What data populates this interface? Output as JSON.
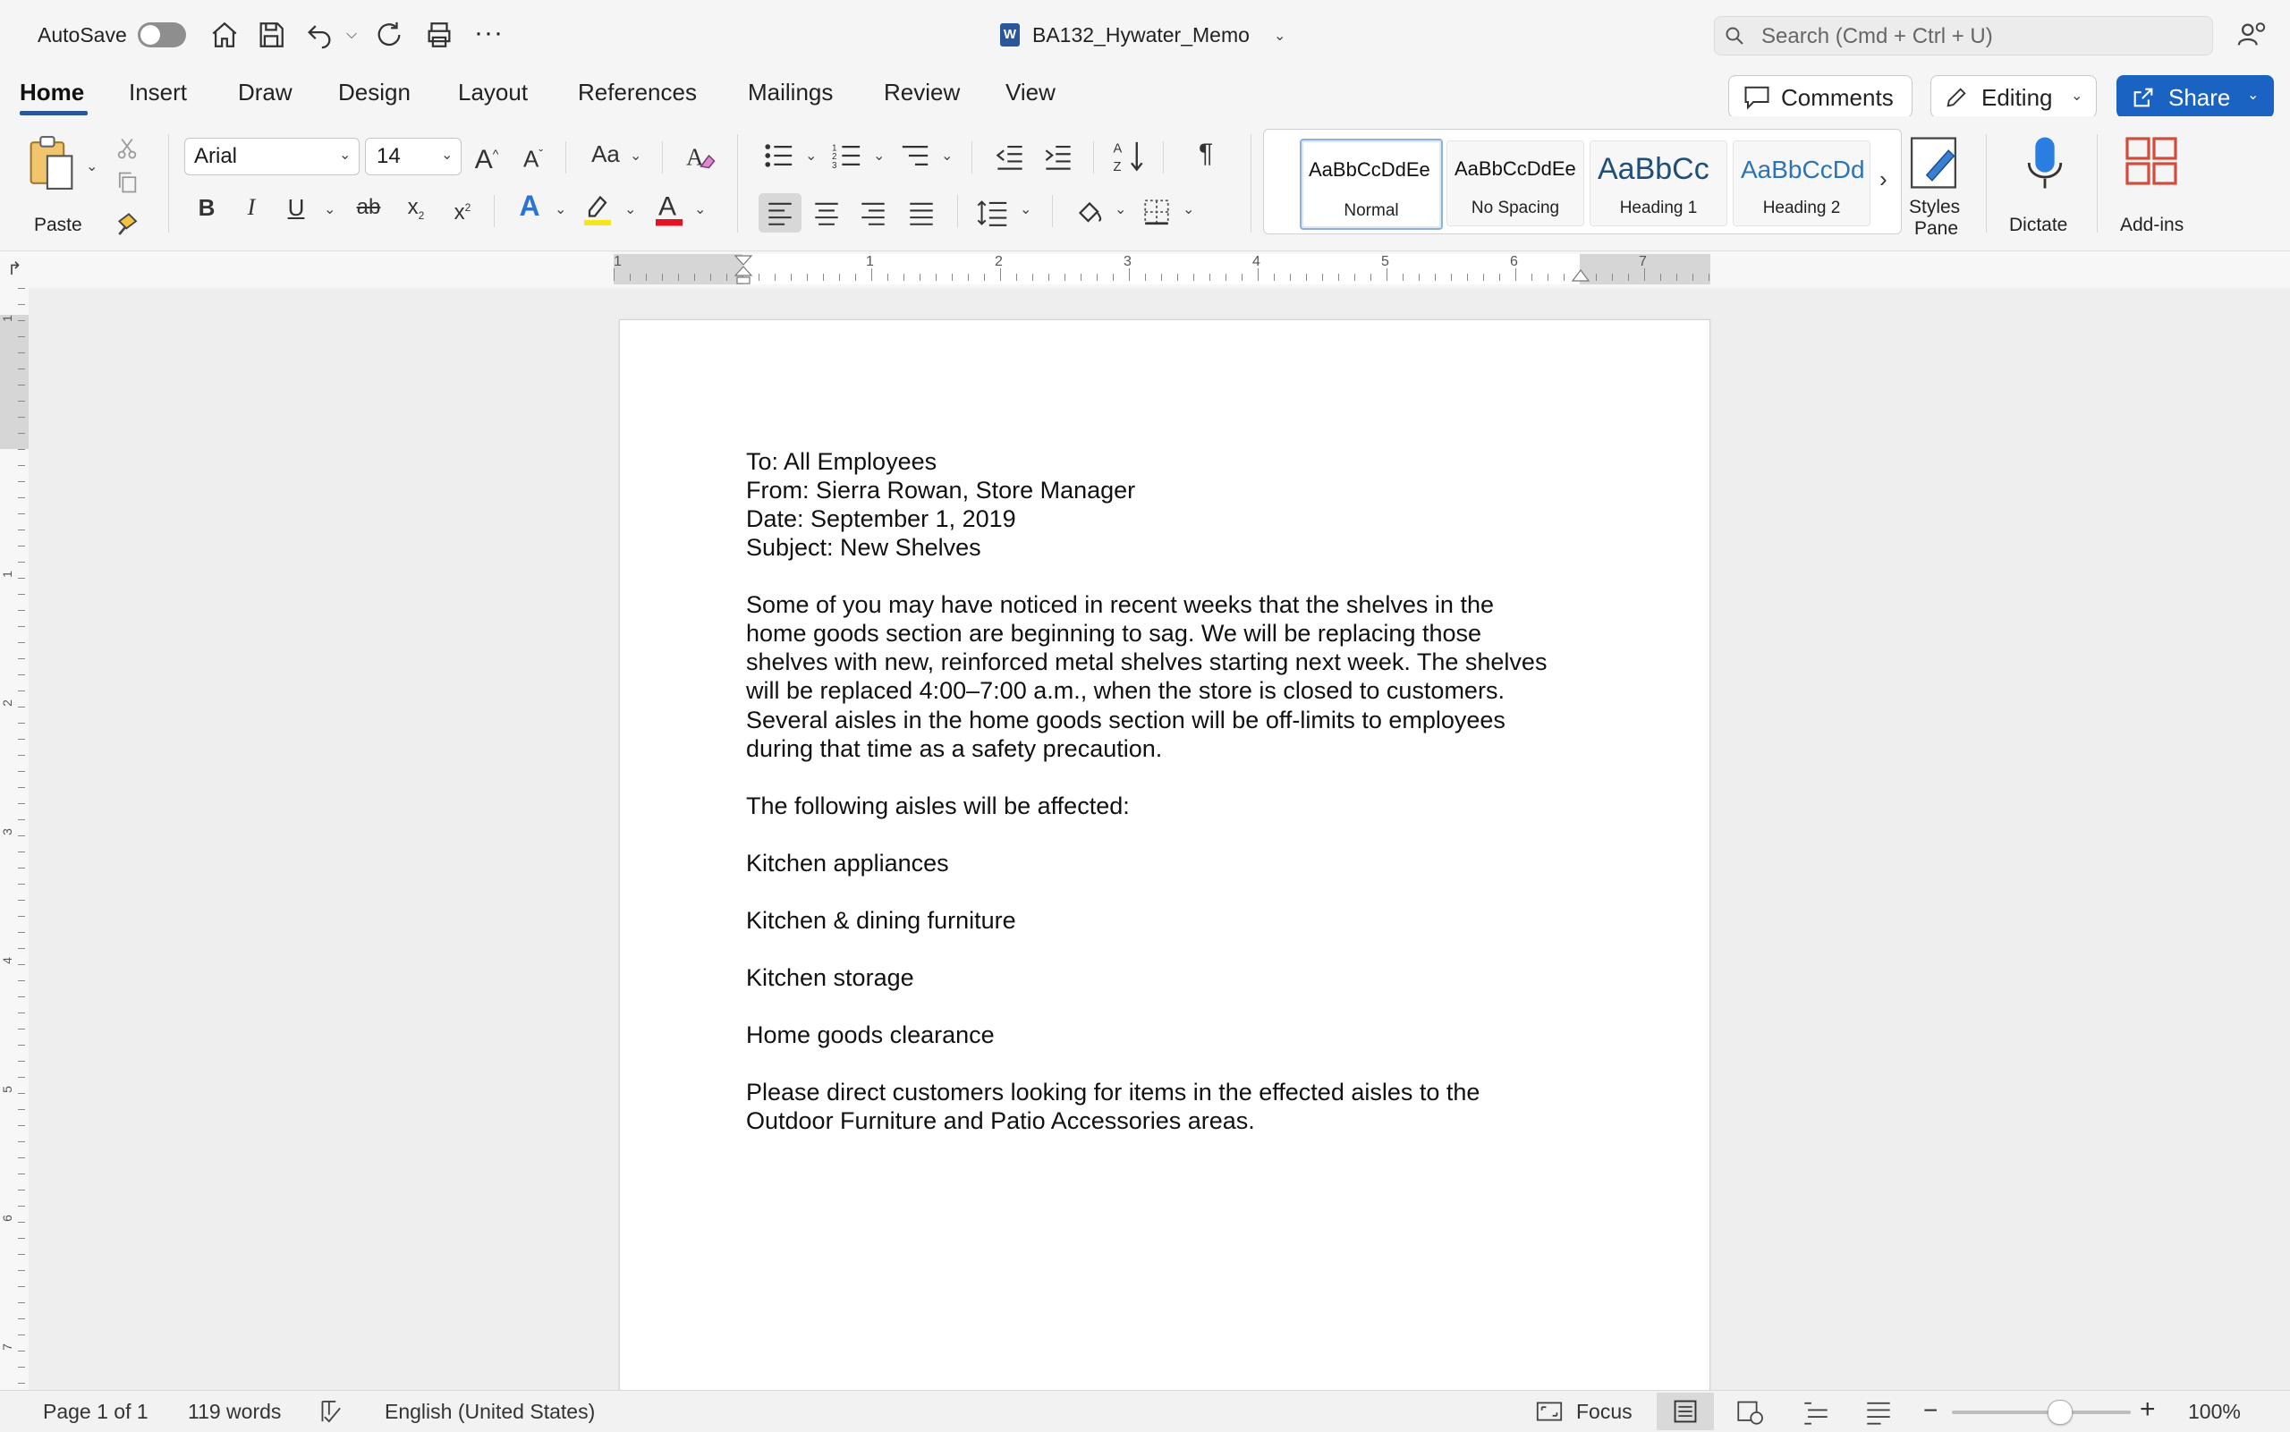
{
  "titlebar": {
    "autosave_label": "AutoSave",
    "doc_title": "BA132_Hywater_Memo",
    "search_placeholder": "Search (Cmd + Ctrl + U)"
  },
  "tabs": [
    {
      "label": "Home",
      "active": true
    },
    {
      "label": "Insert"
    },
    {
      "label": "Draw"
    },
    {
      "label": "Design"
    },
    {
      "label": "Layout"
    },
    {
      "label": "References"
    },
    {
      "label": "Mailings"
    },
    {
      "label": "Review"
    },
    {
      "label": "View"
    }
  ],
  "actions": {
    "comments_label": "Comments",
    "editing_label": "Editing",
    "share_label": "Share"
  },
  "ribbon": {
    "paste_label": "Paste",
    "font_name": "Arial",
    "font_size": "14",
    "styles": [
      {
        "sample": "AaBbCcDdEe",
        "name": "Normal",
        "selected": true
      },
      {
        "sample": "AaBbCcDdEe",
        "name": "No Spacing"
      },
      {
        "sample": "AaBbCc",
        "name": "Heading 1"
      },
      {
        "sample": "AaBbCcDd",
        "name": "Heading 2"
      }
    ],
    "styles_pane_label_1": "Styles",
    "styles_pane_label_2": "Pane",
    "dictate_label": "Dictate",
    "addins_label": "Add-ins",
    "highlight_color": "#f5e51b",
    "font_color": "#e81123"
  },
  "ruler": {
    "h_numbers": [
      "1",
      "1",
      "2",
      "3",
      "4",
      "5",
      "6",
      "7"
    ],
    "v_numbers": [
      "1",
      "1",
      "2",
      "3",
      "4",
      "5",
      "6",
      "7"
    ]
  },
  "document": {
    "header_lines": [
      "To: All Employees",
      "From: Sierra Rowan, Store Manager",
      "Date: September 1, 2019",
      "Subject: New Shelves"
    ],
    "body_lines": [
      "Some of you may have noticed in recent weeks that the shelves in the",
      "home goods section are beginning to sag. We will be replacing those",
      "shelves with new, reinforced metal shelves starting next week. The shelves",
      "will be replaced 4:00–7:00 a.m., when the store is closed to customers.",
      "Several aisles in the home goods section will be off-limits to employees",
      "during that time as a safety precaution."
    ],
    "intro_line": "The following aisles will be affected:",
    "aisles": [
      "Kitchen appliances",
      "Kitchen & dining furniture",
      "Kitchen storage",
      "Home goods clearance"
    ],
    "closing_lines": [
      "Please direct customers looking for items in the effected aisles to the",
      "Outdoor Furniture and Patio Accessories areas."
    ]
  },
  "status": {
    "page": "Page 1 of 1",
    "words": "119 words",
    "language": "English (United States)",
    "focus_label": "Focus",
    "zoom": "100%",
    "zoom_level_percent": 100
  }
}
